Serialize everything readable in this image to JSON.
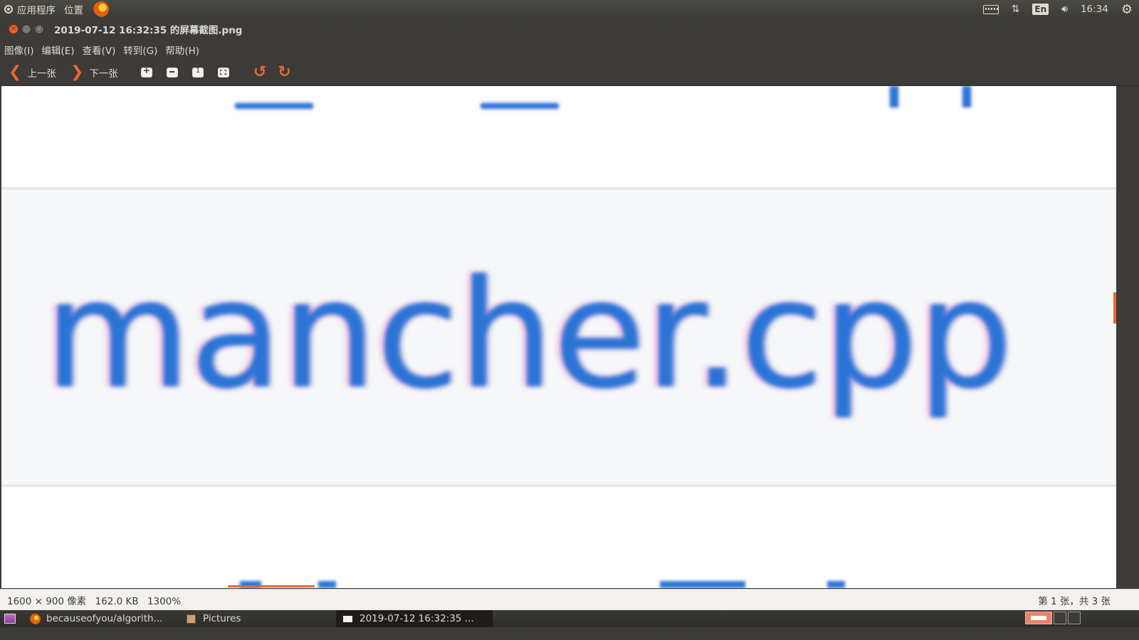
{
  "top_panel": {
    "menu": [
      "应用程序",
      "位置"
    ],
    "indicators": {
      "lang": "En",
      "clock": "16:34"
    }
  },
  "window": {
    "title": "2019-07-12 16:32:35 的屏幕截图.png",
    "menus": [
      "图像(I)",
      "编辑(E)",
      "查看(V)",
      "转到(G)",
      "帮助(H)"
    ],
    "toolbar": {
      "prev_label": "上一张",
      "next_label": "下一张"
    }
  },
  "image": {
    "visible_text": "mancher.cpp"
  },
  "statusbar": {
    "dimensions": "1600 × 900 像素",
    "size": "162.0 KB",
    "zoom": "1300%",
    "position": "第 1 张，共 3 张"
  },
  "taskbar": {
    "tasks": [
      {
        "label": "becauseofyou/algorith...",
        "icon": "firefox-icon"
      },
      {
        "label": "Pictures",
        "icon": "file-manager-icon"
      },
      {
        "label": "2019-07-12 16:32:35 ...",
        "icon": "image-viewer-icon"
      }
    ]
  },
  "colors": {
    "accent": "#e9692c",
    "panel": "#3c3b37",
    "image_text": "#2b74d6"
  }
}
